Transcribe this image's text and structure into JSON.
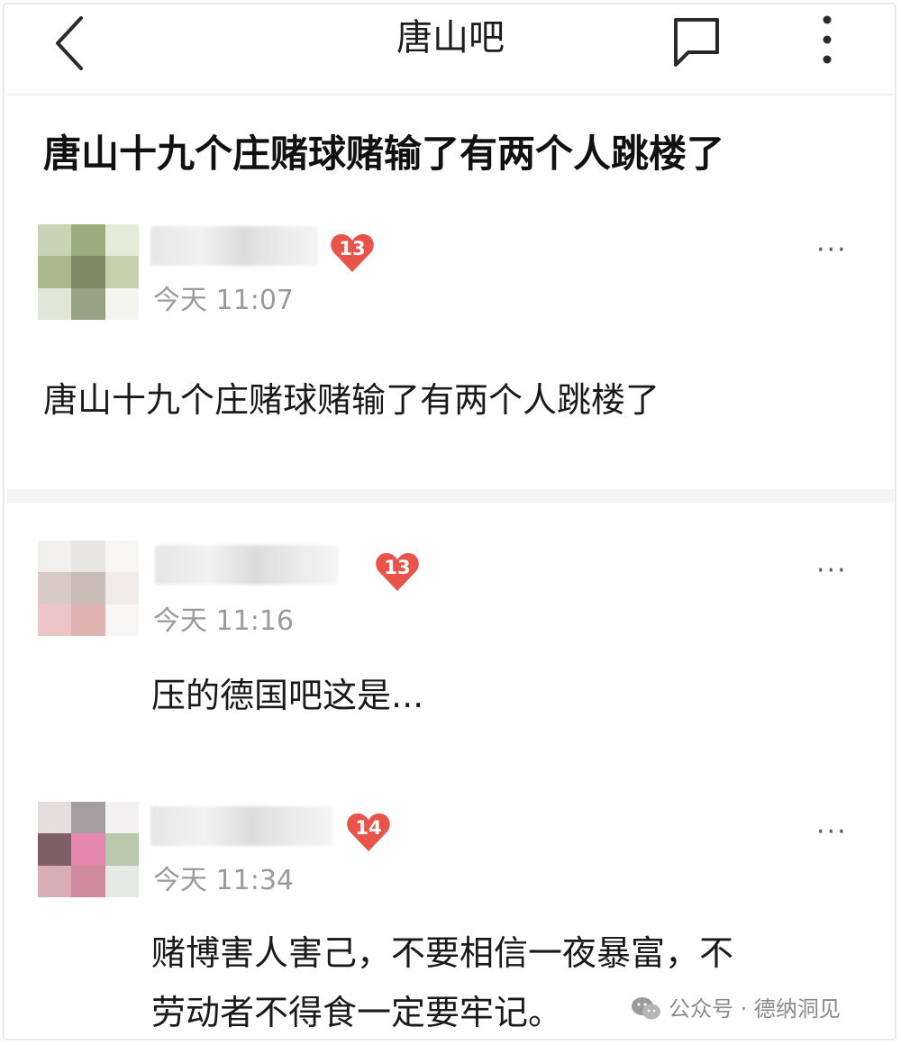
{
  "header": {
    "title": "唐山吧",
    "back_icon": "chevron-left-icon",
    "message_icon": "chat-bubble-icon",
    "more_icon": "more-vertical-icon"
  },
  "thread": {
    "headline": "唐山十九个庄赌球赌输了有两个人跳楼了"
  },
  "posts": [
    {
      "level": "13",
      "time": "今天 11:07",
      "text": "唐山十九个庄赌球赌输了有两个人跳楼了",
      "more": "···"
    },
    {
      "level": "13",
      "time": "今天 11:16",
      "text": "压的德国吧这是...",
      "more": "···"
    },
    {
      "level": "14",
      "time": "今天 11:34",
      "text_line1": "赌博害人害己，不要相信一夜暴富，不",
      "text_line2": "劳动者不得食一定要牢记。",
      "more": "···"
    }
  ],
  "watermark": {
    "text": "公众号 · 德纳洞见",
    "icon": "wechat-icon"
  },
  "colors": {
    "badge": "#e9544a",
    "timestamp": "#9b9b9b",
    "separator": "#f5f5f5"
  }
}
